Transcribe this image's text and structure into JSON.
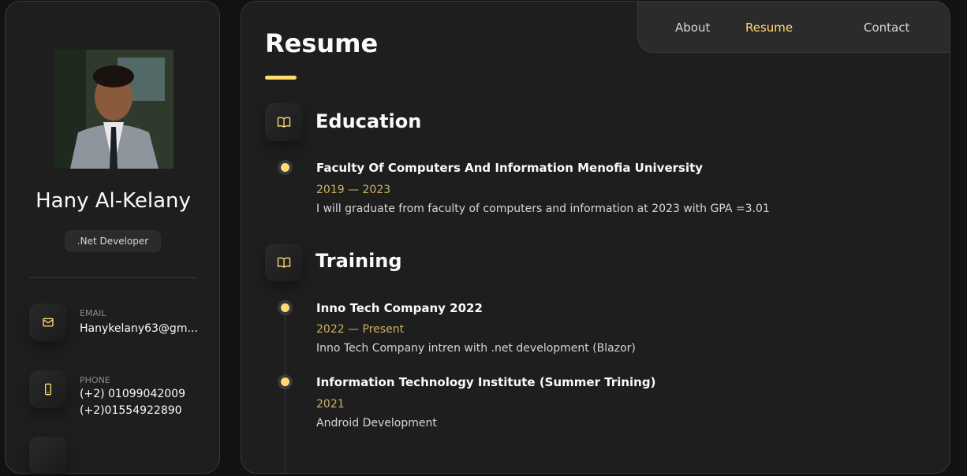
{
  "profile": {
    "name": "Hany Al-Kelany",
    "title": ".Net Developer"
  },
  "contacts": {
    "email": {
      "label": "EMAIL",
      "value": "Hanykelany63@gm...",
      "icon": "mail-icon"
    },
    "phone": {
      "label": "PHONE",
      "value_1": "(+2) 01099042009",
      "value_2": "(+2)01554922890",
      "icon": "phone-icon"
    }
  },
  "nav": {
    "about": "About",
    "resume": "Resume",
    "contact": "Contact",
    "active": "Resume"
  },
  "page": {
    "title": "Resume"
  },
  "education": {
    "title": "Education",
    "icon": "book-icon",
    "items": [
      {
        "title": "Faculty Of Computers And Information Menofia University",
        "date": "2019 — 2023",
        "text": "I will graduate from faculty of computers and information at 2023 with GPA =3.01"
      }
    ]
  },
  "training": {
    "title": "Training",
    "icon": "book-icon",
    "items": [
      {
        "title": "Inno Tech Company 2022",
        "date": "2022 — Present",
        "text": "Inno Tech Company intren with .net development (Blazor)"
      },
      {
        "title": "Information Technology Institute (Summer Trining)",
        "date": "2021",
        "text": "Android Development"
      }
    ]
  },
  "colors": {
    "accent": "#ffdb70",
    "background": "#121212",
    "panel": "#1e1e1f"
  }
}
